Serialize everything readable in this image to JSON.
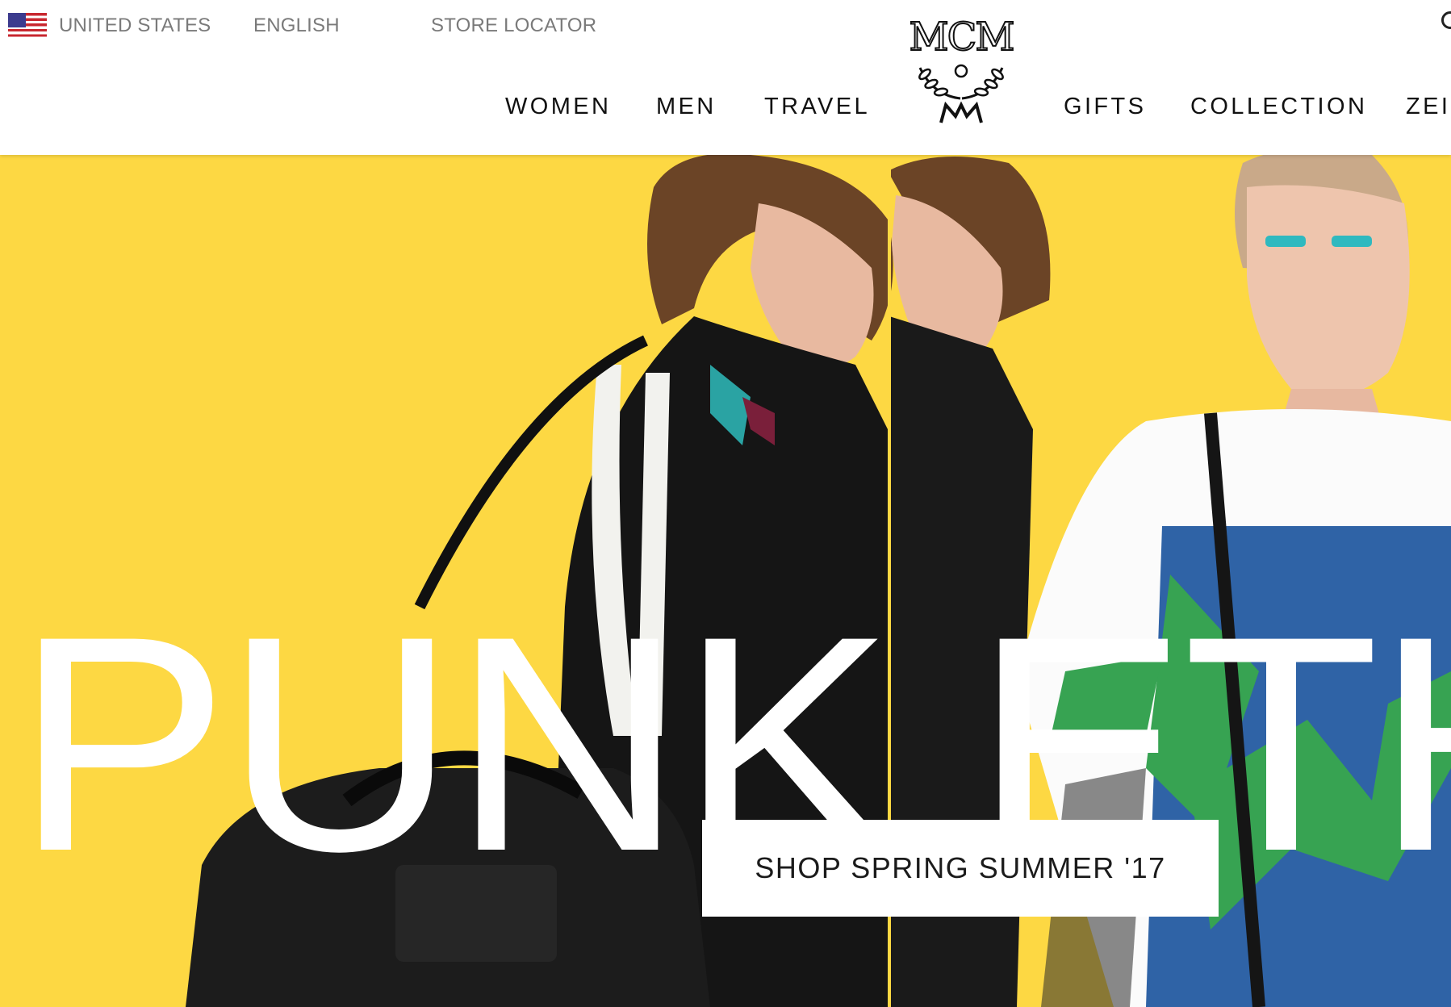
{
  "utility": {
    "country": "UNITED STATES",
    "language": "ENGLISH",
    "store_locator": "STORE LOCATOR"
  },
  "logo": {
    "text": "MCM"
  },
  "nav": {
    "women": "WOMEN",
    "men": "MEN",
    "travel": "TRAVEL",
    "gifts": "GIFTS",
    "collection": "COLLECTION",
    "zeitgeist_partial": "ZEIT"
  },
  "hero": {
    "headline": "PUNK ETH",
    "cta": "SHOP SPRING SUMMER '17",
    "background_color": "#fdd843"
  },
  "icons": [
    "us-flag-icon",
    "mcm-laurel-logo-icon",
    "search-icon"
  ]
}
